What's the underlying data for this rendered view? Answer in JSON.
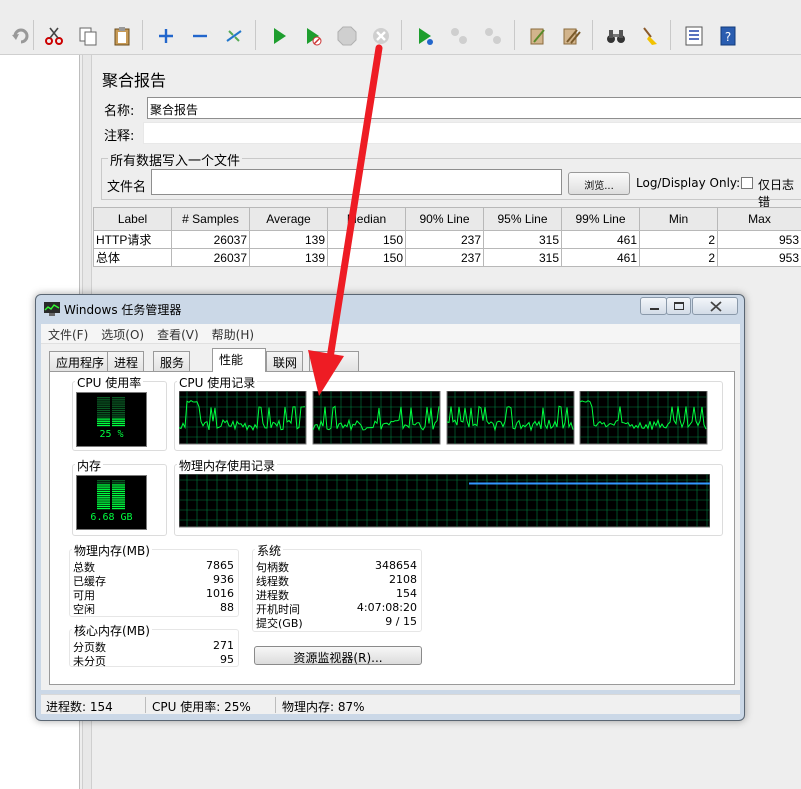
{
  "toolbar": {
    "buttons": [
      "undo",
      "cut",
      "copy",
      "paste",
      "expand",
      "collapse",
      "toggle",
      "start",
      "start-no-pause",
      "stop",
      "shutdown",
      "remote-start",
      "remote-stop",
      "remote-exit",
      "clear",
      "clear-all",
      "search",
      "reset-search",
      "function-helper",
      "help"
    ]
  },
  "report": {
    "title": "聚合报告",
    "name_label": "名称:",
    "name_value": "聚合报告",
    "comment_label": "注释:",
    "comment_value": "",
    "file_section_title": "所有数据写入一个文件",
    "filename_label": "文件名",
    "filename_value": "",
    "browse_label": "浏览...",
    "log_display_label": "Log/Display Only:",
    "errors_only_label": "仅日志错"
  },
  "table": {
    "columns": [
      "Label",
      "# Samples",
      "Average",
      "Median",
      "90% Line",
      "95% Line",
      "99% Line",
      "Min",
      "Max"
    ],
    "rows": [
      [
        "HTTP请求",
        "26037",
        "139",
        "150",
        "237",
        "315",
        "461",
        "2",
        "953"
      ],
      [
        "总体",
        "26037",
        "139",
        "150",
        "237",
        "315",
        "461",
        "2",
        "953"
      ]
    ]
  },
  "taskmgr": {
    "title": "Windows 任务管理器",
    "menu": [
      "文件(F)",
      "选项(O)",
      "查看(V)",
      "帮助(H)"
    ],
    "tabs": [
      "应用程序",
      "进程",
      "服务",
      "性能",
      "联网",
      "用户"
    ],
    "active_tab": "性能",
    "cpu_usage_title": "CPU 使用率",
    "cpu_usage_value": "25 %",
    "cpu_usage_pct": 25,
    "cpu_history_title": "CPU 使用记录",
    "mem_title": "内存",
    "mem_value": "6.68 GB",
    "mem_pct": 87,
    "mem_history_title": "物理内存使用记录",
    "physical_mem": {
      "title": "物理内存(MB)",
      "rows": [
        [
          "总数",
          "7865"
        ],
        [
          "已缓存",
          "936"
        ],
        [
          "可用",
          "1016"
        ],
        [
          "空闲",
          "88"
        ]
      ]
    },
    "kernel_mem": {
      "title": "核心内存(MB)",
      "rows": [
        [
          "分页数",
          "271"
        ],
        [
          "未分页",
          "95"
        ]
      ]
    },
    "system": {
      "title": "系统",
      "rows": [
        [
          "句柄数",
          "348654"
        ],
        [
          "线程数",
          "2108"
        ],
        [
          "进程数",
          "154"
        ],
        [
          "开机时间",
          "4:07:08:20"
        ],
        [
          "提交(GB)",
          "9 / 15"
        ]
      ]
    },
    "resource_monitor_button": "资源监视器(R)...",
    "status": {
      "processes": "进程数: 154",
      "cpu": "CPU 使用率: 25%",
      "memory": "物理内存: 87%"
    },
    "colors": {
      "graph_green": "#00ff40",
      "graph_bg": "#000000",
      "grid": "#008040",
      "mem_line": "#3399ff"
    }
  }
}
